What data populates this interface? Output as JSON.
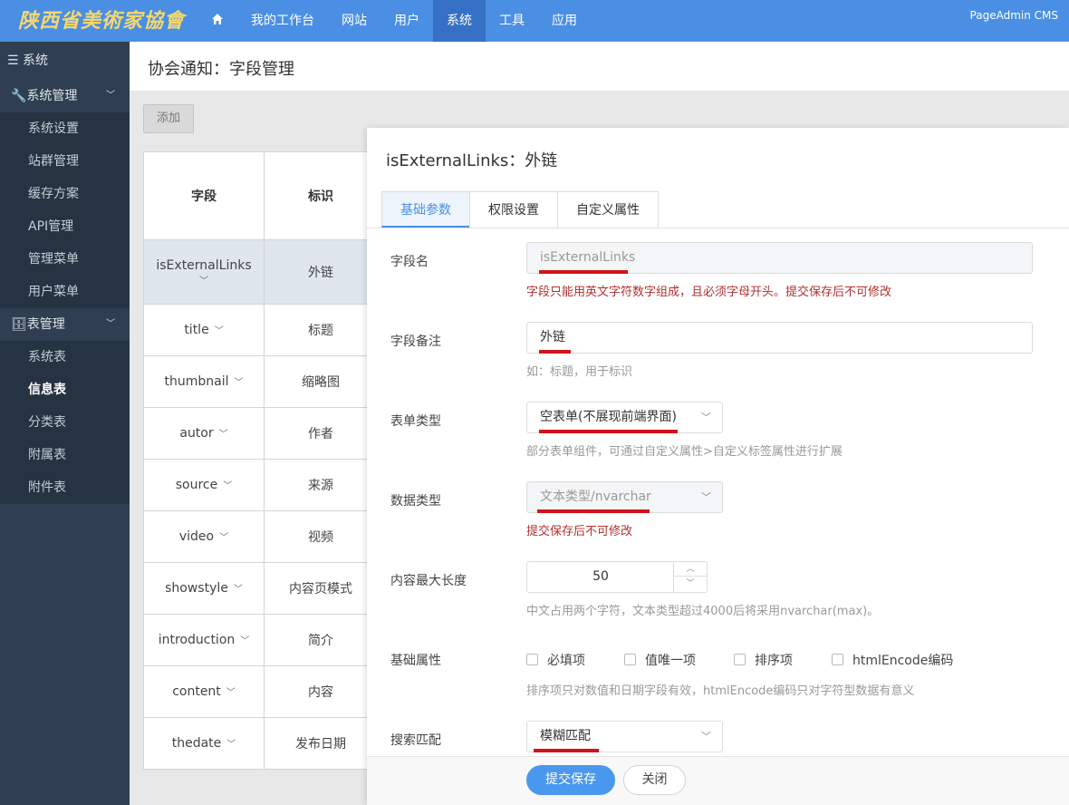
{
  "header": {
    "logo_text": "陕西省美術家協會",
    "nav": [
      "我的工作台",
      "网站",
      "用户",
      "系统",
      "工具",
      "应用"
    ],
    "brand": "PageAdmin CMS"
  },
  "sidebar": {
    "title": "系统",
    "group1": "系统管理",
    "group1_items": [
      "系统设置",
      "站群管理",
      "缓存方案",
      "API管理",
      "管理菜单",
      "用户菜单"
    ],
    "group2": "表管理",
    "group2_items": [
      "系统表",
      "信息表",
      "分类表",
      "附属表",
      "附件表"
    ]
  },
  "page": {
    "title": "协会通知：字段管理",
    "add_button": "添加"
  },
  "table": {
    "headers": [
      "字段",
      "标识"
    ],
    "rows": [
      {
        "field": "isExternalLinks",
        "label": "外链"
      },
      {
        "field": "title",
        "label": "标题"
      },
      {
        "field": "thumbnail",
        "label": "缩略图"
      },
      {
        "field": "autor",
        "label": "作者"
      },
      {
        "field": "source",
        "label": "来源"
      },
      {
        "field": "video",
        "label": "视频"
      },
      {
        "field": "showstyle",
        "label": "内容页模式"
      },
      {
        "field": "introduction",
        "label": "简介"
      },
      {
        "field": "content",
        "label": "内容"
      },
      {
        "field": "thedate",
        "label": "发布日期"
      }
    ]
  },
  "panel": {
    "title": "isExternalLinks：外链",
    "tabs": [
      "基础参数",
      "权限设置",
      "自定义属性"
    ],
    "field_name": {
      "label": "字段名",
      "value": "isExternalLinks",
      "hint": "字段只能用英文字符数字组成，且必须字母开头。提交保存后不可修改"
    },
    "field_note": {
      "label": "字段备注",
      "value": "外链",
      "hint": "如：标题，用于标识"
    },
    "form_type": {
      "label": "表单类型",
      "value": "空表单(不展现前端界面)",
      "hint": "部分表单组件，可通过自定义属性>自定义标签属性进行扩展"
    },
    "data_type": {
      "label": "数据类型",
      "value": "文本类型/nvarchar",
      "hint": "提交保存后不可修改"
    },
    "max_length": {
      "label": "内容最大长度",
      "value": "50",
      "hint": "中文占用两个字符，文本类型超过4000后将采用nvarchar(max)。"
    },
    "base_attrs": {
      "label": "基础属性",
      "options": [
        "必填项",
        "值唯一项",
        "排序项",
        "htmlEncode编码"
      ],
      "hint": "排序项只对数值和日期字段有效，htmlEncode编码只对字符型数据有意义"
    },
    "search_match": {
      "label": "搜索匹配",
      "value": "模糊匹配"
    },
    "submit": "提交保存",
    "close": "关闭"
  }
}
